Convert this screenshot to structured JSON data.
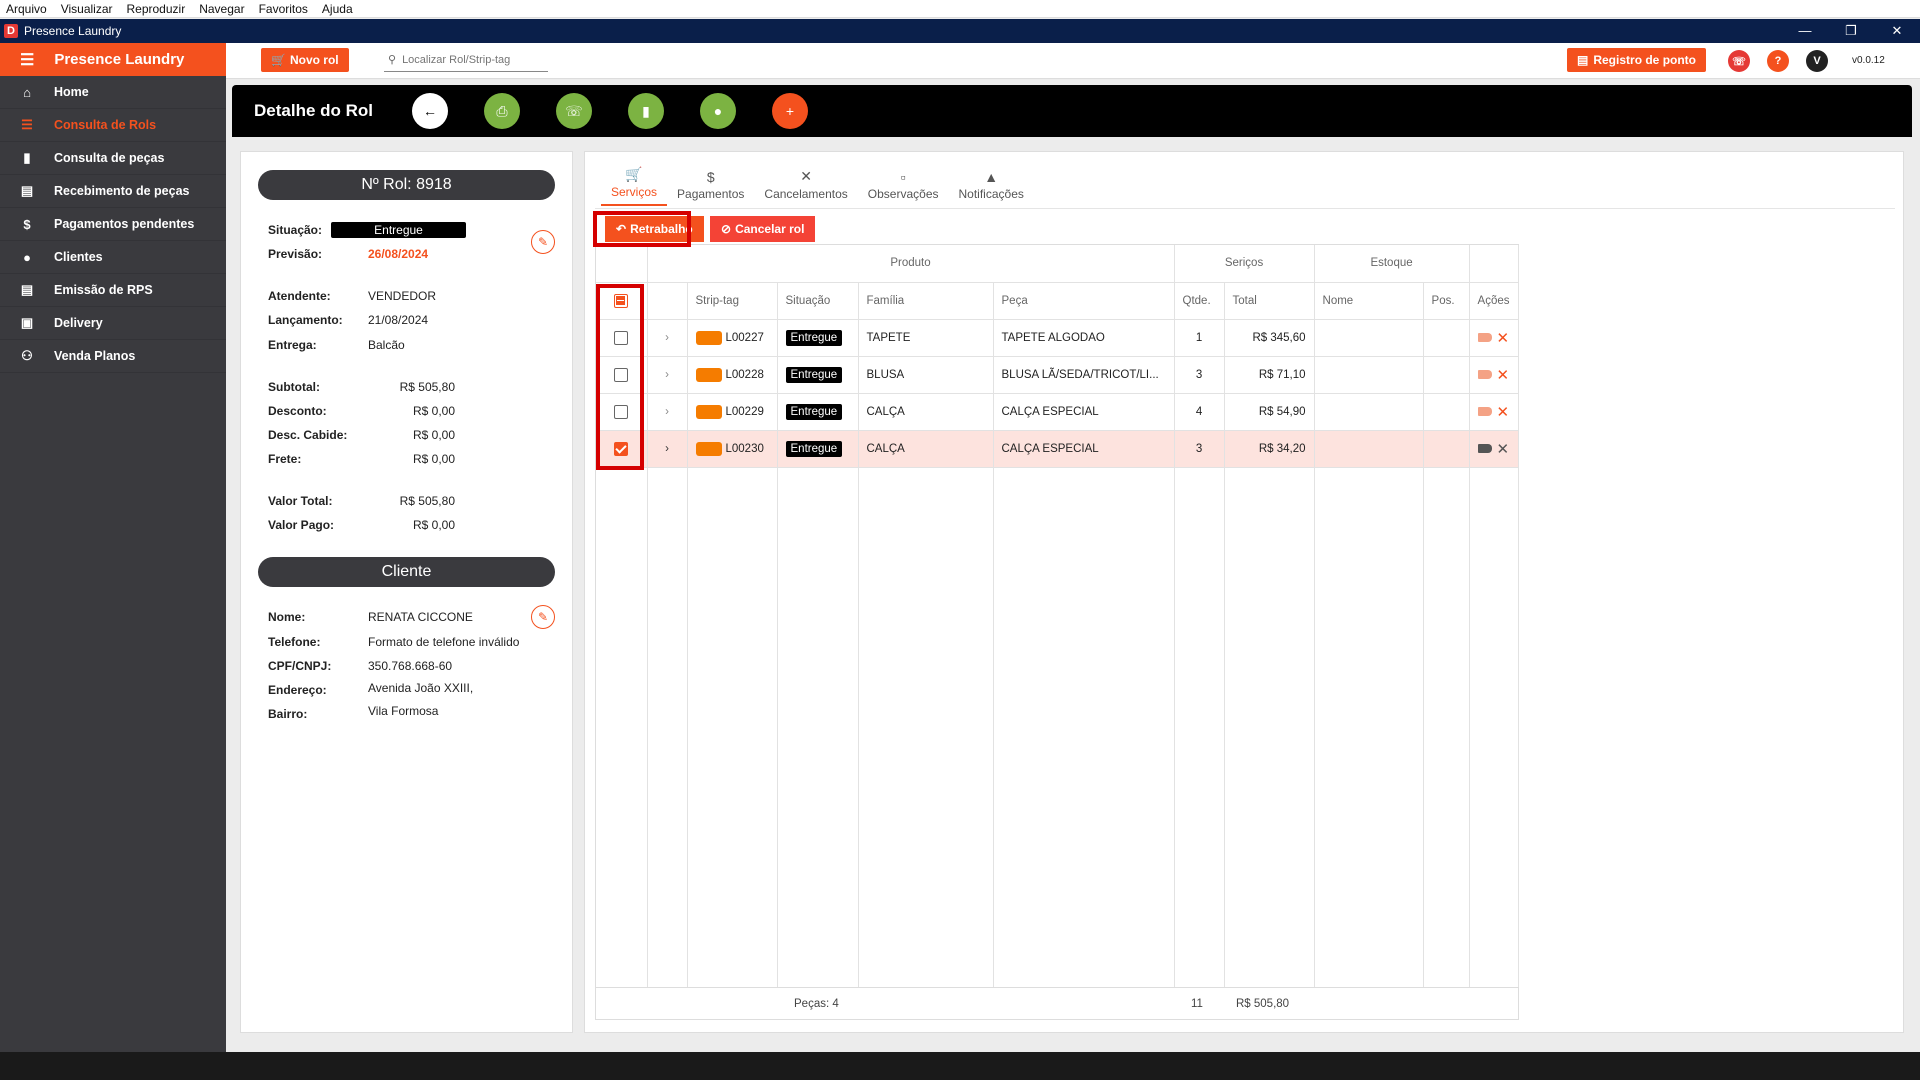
{
  "menubar": [
    "Arquivo",
    "Visualizar",
    "Reproduzir",
    "Navegar",
    "Favoritos",
    "Ajuda"
  ],
  "window": {
    "title": "Presence Laundry",
    "icon_letter": "D"
  },
  "sidebar": {
    "brand": "Presence Laundry",
    "items": [
      {
        "label": "Home",
        "icon": "home-icon"
      },
      {
        "label": "Consulta de Rols",
        "icon": "list-icon",
        "active": true
      },
      {
        "label": "Consulta de peças",
        "icon": "tag-icon"
      },
      {
        "label": "Recebimento de peças",
        "icon": "cart-icon"
      },
      {
        "label": "Pagamentos pendentes",
        "icon": "dollar-icon"
      },
      {
        "label": "Clientes",
        "icon": "person-icon"
      },
      {
        "label": "Emissão de RPS",
        "icon": "document-icon"
      },
      {
        "label": "Delivery",
        "icon": "truck-icon"
      },
      {
        "label": "Venda Planos",
        "icon": "plan-icon"
      }
    ]
  },
  "header": {
    "novo_rol": "Novo rol",
    "search_placeholder": "Localizar Rol/Strip-tag",
    "registro_ponto": "Registro de ponto",
    "avatar_letter": "V",
    "version": "v0.0.12"
  },
  "page": {
    "title": "Detalhe do Rol"
  },
  "rol": {
    "numero": "Nº Rol: 8918",
    "situacao_label": "Situação:",
    "situacao": "Entregue",
    "previsao_label": "Previsão:",
    "previsao": "26/08/2024",
    "atendente_label": "Atendente:",
    "atendente": "VENDEDOR",
    "lancamento_label": "Lançamento:",
    "lancamento": "21/08/2024",
    "entrega_label": "Entrega:",
    "entrega": "Balcão",
    "subtotal_label": "Subtotal:",
    "subtotal": "R$ 505,80",
    "desconto_label": "Desconto:",
    "desconto": "R$ 0,00",
    "desc_cabide_label": "Desc. Cabide:",
    "desc_cabide": "R$ 0,00",
    "frete_label": "Frete:",
    "frete": "R$ 0,00",
    "valor_total_label": "Valor Total:",
    "valor_total": "R$ 505,80",
    "valor_pago_label": "Valor Pago:",
    "valor_pago": "R$ 0,00"
  },
  "cliente": {
    "header": "Cliente",
    "nome_label": "Nome:",
    "nome": "RENATA CICCONE",
    "telefone_label": "Telefone:",
    "telefone": "Formato de telefone inválido",
    "cpf_label": "CPF/CNPJ:",
    "cpf": "350.768.668-60",
    "endereco_label": "Endereço:",
    "endereco": "Avenida João XXIII,",
    "bairro_label": "Bairro:",
    "bairro": "Vila Formosa"
  },
  "tabs": [
    {
      "label": "Serviços",
      "icon": "cart-icon",
      "active": true
    },
    {
      "label": "Pagamentos",
      "icon": "dollar-icon"
    },
    {
      "label": "Cancelamentos",
      "icon": "close-icon"
    },
    {
      "label": "Observações",
      "icon": "comment-icon"
    },
    {
      "label": "Notificações",
      "icon": "bell-icon"
    }
  ],
  "actions": {
    "retrabalho": "Retrabalho",
    "cancelar_rol": "Cancelar rol"
  },
  "table": {
    "groups": {
      "produto": "Produto",
      "servicos": "Seriços",
      "estoque": "Estoque"
    },
    "columns": [
      "Strip-tag",
      "Situação",
      "Família",
      "Peça",
      "Qtde.",
      "Total",
      "Nome",
      "Pos.",
      "Ações"
    ],
    "rows": [
      {
        "tag": "L00227",
        "situacao": "Entregue",
        "familia": "TAPETE",
        "peca": "TAPETE ALGODAO",
        "qtde": "1",
        "total": "R$ 345,60",
        "checked": false
      },
      {
        "tag": "L00228",
        "situacao": "Entregue",
        "familia": "BLUSA",
        "peca": "BLUSA LÃ/SEDA/TRICOT/LI...",
        "qtde": "3",
        "total": "R$ 71,10",
        "checked": false
      },
      {
        "tag": "L00229",
        "situacao": "Entregue",
        "familia": "CALÇA",
        "peca": "CALÇA ESPECIAL",
        "qtde": "4",
        "total": "R$ 54,90",
        "checked": false
      },
      {
        "tag": "L00230",
        "situacao": "Entregue",
        "familia": "CALÇA",
        "peca": "CALÇA ESPECIAL",
        "qtde": "3",
        "total": "R$ 34,20",
        "checked": true
      }
    ],
    "footer": {
      "pecas": "Peças: 4",
      "qtde_total": "11",
      "valor_total": "R$ 505,80"
    }
  },
  "colors": {
    "accent": "#f4511e",
    "sidebar": "#3a3a3e",
    "green": "#7cb342",
    "highlight_box": "#d50000",
    "selected_row": "#fde3de"
  }
}
